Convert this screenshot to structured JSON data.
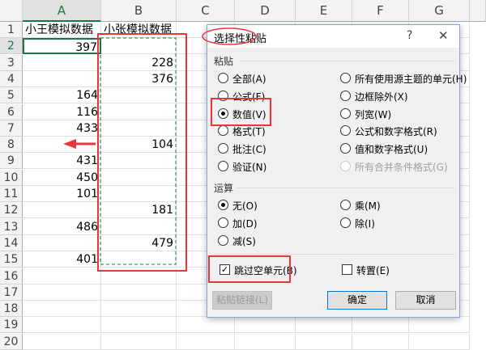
{
  "columns": [
    "A",
    "B",
    "C",
    "D",
    "E",
    "F",
    "G"
  ],
  "rows": [
    "1",
    "2",
    "3",
    "4",
    "5",
    "6",
    "7",
    "8",
    "9",
    "10",
    "11",
    "12",
    "13",
    "14",
    "15",
    "16",
    "17",
    "18",
    "19",
    "20"
  ],
  "headers": {
    "A": "小王模拟数据",
    "B": "小张模拟数据"
  },
  "colA": {
    "2": "397",
    "5": "164",
    "6": "116",
    "7": "433",
    "9": "431",
    "10": "450",
    "11": "101",
    "13": "486",
    "15": "401"
  },
  "colB": {
    "3": "228",
    "4": "376",
    "8": "104",
    "12": "181",
    "14": "479"
  },
  "dialog": {
    "title": "选择性粘贴",
    "help": "?",
    "close": "✕",
    "paste_label": "粘贴",
    "paste_left": [
      {
        "label": "全部(A)",
        "on": false
      },
      {
        "label": "公式(F)",
        "on": false
      },
      {
        "label": "数值(V)",
        "on": true
      },
      {
        "label": "格式(T)",
        "on": false
      },
      {
        "label": "批注(C)",
        "on": false
      },
      {
        "label": "验证(N)",
        "on": false
      }
    ],
    "paste_right": [
      {
        "label": "所有使用源主题的单元(H)"
      },
      {
        "label": "边框除外(X)"
      },
      {
        "label": "列宽(W)"
      },
      {
        "label": "公式和数字格式(R)"
      },
      {
        "label": "值和数字格式(U)"
      },
      {
        "label": "所有合并条件格式(G)",
        "disabled": true
      }
    ],
    "op_label": "运算",
    "op_left": [
      {
        "label": "无(O)",
        "on": true
      },
      {
        "label": "加(D)"
      },
      {
        "label": "减(S)"
      }
    ],
    "op_right": [
      {
        "label": "乘(M)"
      },
      {
        "label": "除(I)"
      }
    ],
    "skip_blanks": {
      "label": "跳过空单元(B)",
      "checked": true
    },
    "transpose": {
      "label": "转置(E)",
      "checked": false
    },
    "paste_link": "粘贴链接(L)",
    "ok": "确定",
    "cancel": "取消"
  },
  "accent": "#217346",
  "annotation": "#e8363a"
}
